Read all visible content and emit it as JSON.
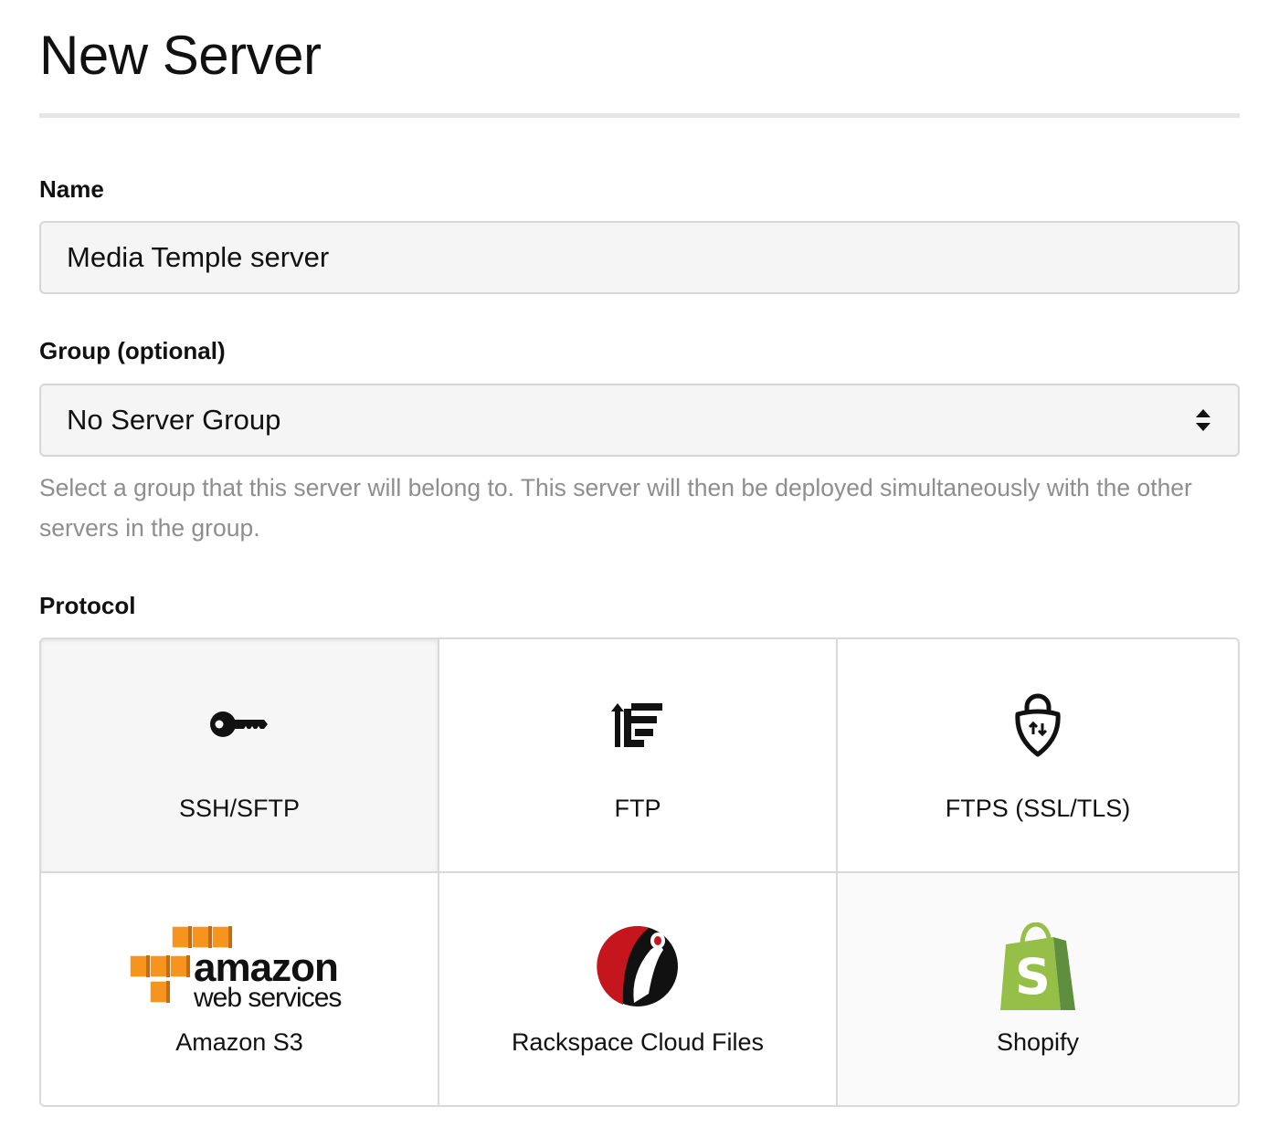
{
  "page": {
    "title": "New Server"
  },
  "name_field": {
    "label": "Name",
    "value": "Media Temple server"
  },
  "group_field": {
    "label": "Group (optional)",
    "selected": "No Server Group",
    "help": "Select a group that this server will belong to. This server will then be deployed simultaneously with the other servers in the group."
  },
  "protocol": {
    "label": "Protocol",
    "options": [
      {
        "label": "SSH/SFTP",
        "icon": "key-icon",
        "selected": true
      },
      {
        "label": "FTP",
        "icon": "ftp-icon"
      },
      {
        "label": "FTPS (SSL/TLS)",
        "icon": "shield-lock-icon"
      },
      {
        "label": "Amazon S3",
        "icon": "amazon-web-services-logo",
        "logo_text": [
          "amazon",
          "web services"
        ]
      },
      {
        "label": "Rackspace Cloud Files",
        "icon": "rackspace-logo"
      },
      {
        "label": "Shopify",
        "icon": "shopify-bag-logo",
        "logo_text": "S"
      }
    ]
  },
  "colors": {
    "aws_orange": "#f7941e",
    "rackspace_red": "#c4161c",
    "shopify_green_light": "#95bf47",
    "shopify_green_dark": "#5e8e3e",
    "help_text": "#8e8e8e"
  }
}
